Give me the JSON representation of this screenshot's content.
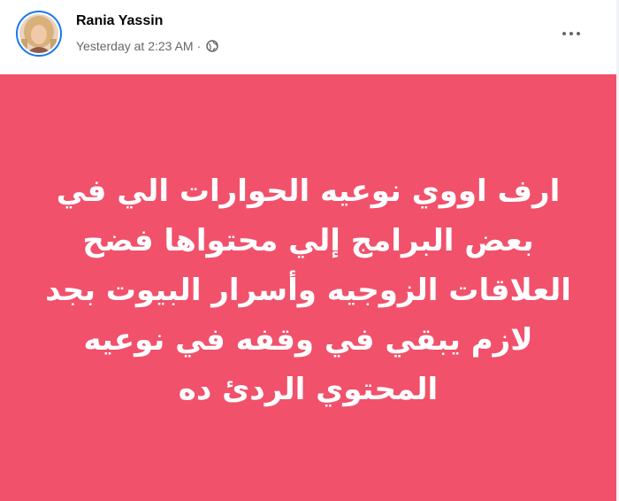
{
  "post": {
    "author": "Rania Yassin",
    "timestamp": "Yesterday at 2:23 AM",
    "separator": "·",
    "audience_icon": "globe-icon",
    "menu_icon": "more-options-icon",
    "background_color": "#f1516b",
    "text_color": "#ffffff",
    "lines": [
      "ارف اووي نوعيه الحوارات الي في",
      "بعض البرامج إلي محتواها فضح",
      "العلاقات الزوجيه وأسرار البيوت بجد",
      "لازم يبقي في وقفه في نوعيه",
      "المحتوي الردئ ده"
    ]
  }
}
